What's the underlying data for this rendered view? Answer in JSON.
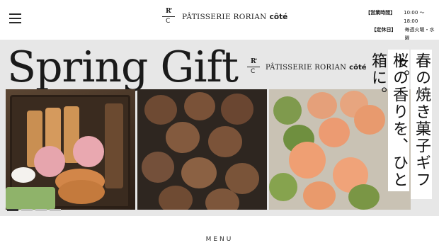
{
  "header": {
    "logo_mark_r": "R",
    "logo_mark_c": "C",
    "brand_name": "PÂTISSERIE RORIAN",
    "brand_suffix": "côté",
    "hours": [
      {
        "label": "【営業時間】",
        "value": "10:00 〜 18:00"
      },
      {
        "label": "【定休日】",
        "value": "毎週火曜・水曜"
      }
    ]
  },
  "hero": {
    "title": "Spring Gift",
    "brand_name": "PÂTISSERIE RORIAN",
    "brand_suffix": "côté",
    "copy_line_1": "春の焼き菓子ギフト。",
    "copy_line_2": "桜の香りを、ひと箱に。",
    "slides_total": 4,
    "active_slide": 1
  },
  "menu_label": "MENU",
  "colors": {
    "hero_bg": "#e7e7e7",
    "text": "#1a1a1a",
    "dot_active": "#333333",
    "dot_inactive": "#c4c4c4"
  }
}
